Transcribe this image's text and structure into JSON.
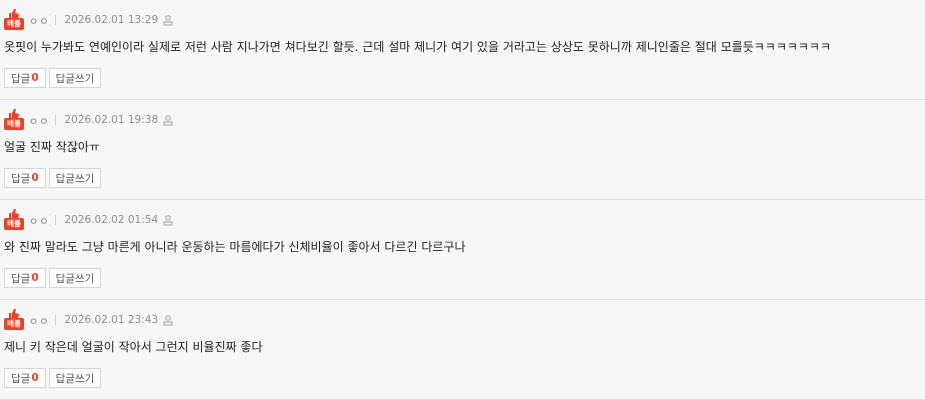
{
  "comments": [
    {
      "badge": "배틀",
      "nickname": "ㅇㅇ",
      "date": "2026.02.01 13:29",
      "text": "옷핏이 누가봐도 연예인이라 실제로 저런 사람 지나가면 쳐다보긴 할듯. 근데 설마 제니가 여기 있을 거라고는 상상도 못하니까 제니인줄은 절대 모를듯ㅋㅋㅋㅋㅋㅋㅋ",
      "reply_label": "답글",
      "reply_count": "0",
      "write_reply_label": "답글쓰기"
    },
    {
      "badge": "배틀",
      "nickname": "ㅇㅇ",
      "date": "2026.02.01 19:38",
      "text": "얼굴 진짜 작잖아ㅠ",
      "reply_label": "답글",
      "reply_count": "0",
      "write_reply_label": "답글쓰기"
    },
    {
      "badge": "배틀",
      "nickname": "ㅇㅇ",
      "date": "2026.02.02 01:54",
      "text": "와 진짜 말라도 그냥 마른게 아니라 운동하는 마름에다가 신체비율이 좋아서 다르긴 다르구나",
      "reply_label": "답글",
      "reply_count": "0",
      "write_reply_label": "답글쓰기"
    },
    {
      "badge": "배틀",
      "nickname": "ㅇㅇ",
      "date": "2026.02.01 23:43",
      "text": "제니 키 작은데 얼굴이 작아서 그런지 비율진짜 좋다",
      "reply_label": "답글",
      "reply_count": "0",
      "write_reply_label": "답글쓰기"
    }
  ],
  "colors": {
    "accent": "#e8422c",
    "meta_text": "#8e8e8e",
    "border": "#d6d6d6"
  }
}
